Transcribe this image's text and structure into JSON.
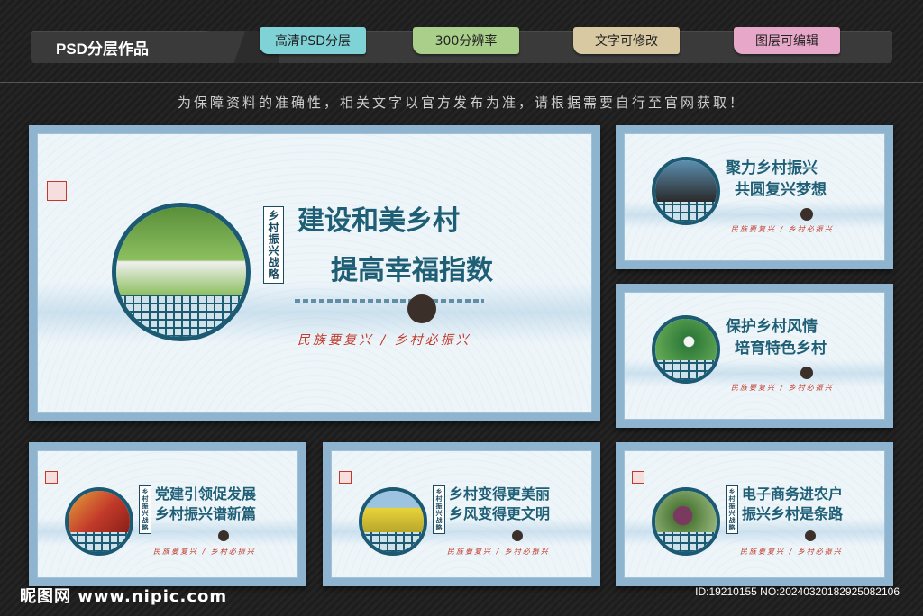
{
  "header": {
    "title": "PSD分层作品",
    "tags": [
      {
        "label": "高清PSD分层",
        "color": "#7fd3d6"
      },
      {
        "label": "300分辨率",
        "color": "#a9cf8a"
      },
      {
        "label": "文字可修改",
        "color": "#d8c9a3"
      },
      {
        "label": "图层可编辑",
        "color": "#e7a7c8"
      }
    ]
  },
  "notice": "为保障资料的准确性，相关文字以官方发布为准，请根据需要自行至官网获取！",
  "boards": [
    {
      "vertical_tag": "乡村振兴战略",
      "line1": "建设和美乡村",
      "line2": "提高幸福指数",
      "slogan": "民族要复兴 / 乡村必振兴",
      "photo_colors": [
        "#5a8f3a",
        "#8cbf5f"
      ]
    },
    {
      "vertical_tag": "",
      "line1": "聚力乡村振兴",
      "line2": "共圆复兴梦想",
      "slogan": "民族要复兴 / 乡村必振兴",
      "photo_colors": [
        "#5c8fb0",
        "#2a2a2a"
      ]
    },
    {
      "vertical_tag": "",
      "line1": "保护乡村风情",
      "line2": "培育特色乡村",
      "slogan": "民族要复兴 / 乡村必振兴",
      "photo_colors": [
        "#2f7a3a",
        "#6fb25a"
      ]
    },
    {
      "vertical_tag": "乡村振兴战略",
      "line1": "党建引领促发展",
      "line2": "乡村振兴谱新篇",
      "slogan": "民族要复兴 / 乡村必振兴",
      "photo_colors": [
        "#c23a2a",
        "#e6a23c"
      ]
    },
    {
      "vertical_tag": "乡村振兴战略",
      "line1": "乡村变得更美丽",
      "line2": "乡风变得更文明",
      "slogan": "民族要复兴 / 乡村必振兴",
      "photo_colors": [
        "#9cc3e0",
        "#e8d33a"
      ]
    },
    {
      "vertical_tag": "乡村振兴战略",
      "line1": "电子商务进农户",
      "line2": "振兴乡村是条路",
      "slogan": "民族要复兴 / 乡村必振兴",
      "photo_colors": [
        "#4f7a3a",
        "#7a3a5f"
      ]
    }
  ],
  "footer": {
    "logo": "昵图网 www.nipic.com",
    "id": "ID:19210155 NO:20240320182925082106"
  }
}
